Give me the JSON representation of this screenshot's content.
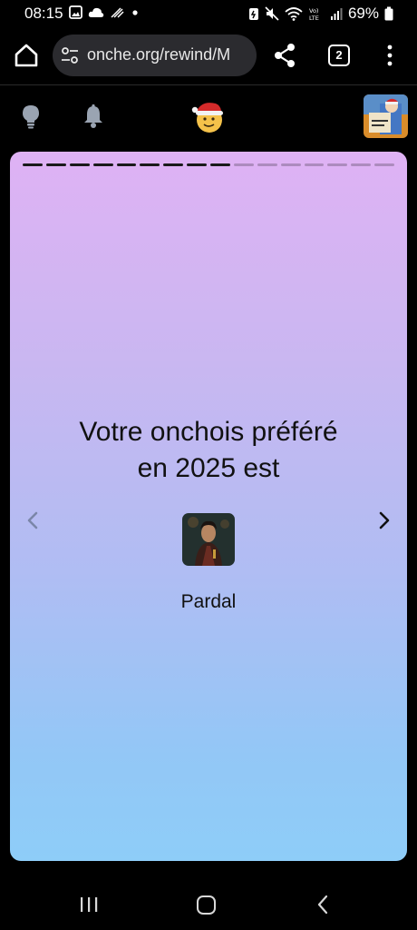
{
  "status_bar": {
    "time": "08:15",
    "battery": "69%",
    "left_icons": [
      "image-icon",
      "cloud-icon",
      "signal-strike-icon",
      "dot-icon"
    ],
    "right_icons": [
      "battery-saver-icon",
      "mute-icon",
      "wifi-icon",
      "volte-icon",
      "cell-signal-icon",
      "battery-icon"
    ]
  },
  "browser": {
    "url": "onche.org/rewind/M",
    "tab_count": "2",
    "icons": [
      "home-icon",
      "tune-icon",
      "share-icon",
      "tabs-icon",
      "kebab-menu-icon"
    ]
  },
  "site_header": {
    "icons": [
      "lightbulb-icon",
      "bell-icon",
      "santa-logo-icon",
      "user-avatar"
    ]
  },
  "story": {
    "progress_total": 16,
    "progress_done": 9,
    "title_line1": "Votre onchois préféré",
    "title_line2": "en 2025 est",
    "favorite_name": "Pardal",
    "colors": {
      "top": "#dfb2f4",
      "bottom": "#8ecdf8",
      "text": "#111111"
    }
  },
  "android_nav": {
    "icons": [
      "recents-icon",
      "home-icon",
      "back-icon"
    ]
  }
}
